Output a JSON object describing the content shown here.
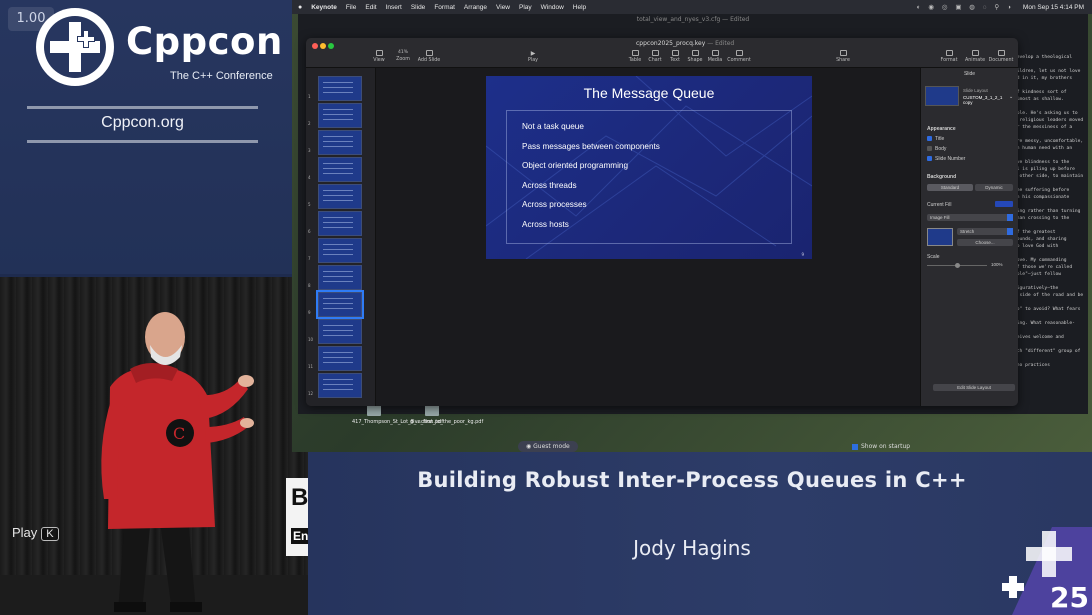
{
  "player": {
    "speed": "1.00",
    "play_label": "Play",
    "play_key": "K"
  },
  "brand": {
    "name": "Cppcon",
    "tagline": "The C++ Conference",
    "url": "Cppcon.org",
    "year_badge": "25"
  },
  "talk": {
    "title": "Building Robust Inter-Process Queues in C++",
    "speaker": "Jody Hagins"
  },
  "lectern": {
    "line1": "B",
    "line2": "En"
  },
  "macos": {
    "menubar": [
      "Keynote",
      "File",
      "Edit",
      "Insert",
      "Slide",
      "Format",
      "Arrange",
      "View",
      "Play",
      "Window",
      "Help"
    ],
    "clock": "Mon Sep 15  4:14 PM",
    "bg_window_title": "total_view_and_nyes_v3.cfg — Edited",
    "desktop_files": [
      "417_Thompson_St_Lot_8_...ction.pdf",
      "give_first_to_the_poor_kg.pdf"
    ],
    "guest_mode": "Guest mode",
    "show_on_startup": "Show on startup"
  },
  "keynote": {
    "doc_title": "cppcon2025_procq.key",
    "doc_status": "— Edited",
    "zoom": "41%",
    "toolbar": {
      "view": "View",
      "zoom": "Zoom",
      "add_slide": "Add Slide",
      "play": "Play",
      "table": "Table",
      "chart": "Chart",
      "text": "Text",
      "shape": "Shape",
      "media": "Media",
      "comment": "Comment",
      "share": "Share",
      "format": "Format",
      "animate": "Animate",
      "document": "Document"
    },
    "slide_numbers": [
      "1",
      "2",
      "3",
      "4",
      "5",
      "6",
      "7",
      "8",
      "9",
      "10",
      "11",
      "12"
    ],
    "selected_slide": 9,
    "slide": {
      "title": "The Message Queue",
      "bullets": [
        "Not a task queue",
        "Pass messages between components",
        "Object oriented programming",
        "Across threads",
        "Across processes",
        "Across hosts"
      ],
      "number": "9"
    },
    "inspector": {
      "header": "Slide",
      "layout_label": "Slide Layout",
      "layout_value": "CUSTOM_3_1_2_1 copy",
      "appearance": "Appearance",
      "checks": [
        {
          "label": "Title",
          "checked": true
        },
        {
          "label": "Body",
          "checked": false
        },
        {
          "label": "Slide Number",
          "checked": true
        }
      ],
      "background": "Background",
      "bg_tabs": [
        "Standard",
        "Dynamic"
      ],
      "current_fill": "Current Fill",
      "fill_type": "Image Fill",
      "stretch": "Stretch",
      "choose": "Choose...",
      "scale": "Scale",
      "scale_value": "100%",
      "edit_layout": "Edit Slide Layout"
    }
  },
  "bg_doc_lines": [
    "develop a theological",
    "",
    "hildren, let us not love",
    "ed in it, my brothers",
    "",
    "of kindness sort of",
    "almost as shallow.",
    "",
    "ople. He's asking us to",
    "e religious leaders moved",
    "or the messiness of a",
    "",
    "are messy, uncomfortable,",
    "ch human need with an",
    "",
    "lve blindness to the",
    "il is piling up before",
    "e other side, to maintain",
    "",
    "the suffering before",
    "in his compassionate",
    "",
    "ring rather than turning",
    "than crossing to the",
    "",
    "of the greatest",
    "wounds, and sharing",
    "to love God with",
    "",
    "love. My commanding",
    "of those we're called",
    "ople\"—just fellow",
    "",
    "figuratively—the",
    "y side of the road and be",
    "",
    "do\" to avoid? What fears",
    "",
    "ping. What reasonable-",
    "",
    "ceives welcome and",
    "",
    "ich \"different\" group of",
    "",
    "who practices"
  ]
}
